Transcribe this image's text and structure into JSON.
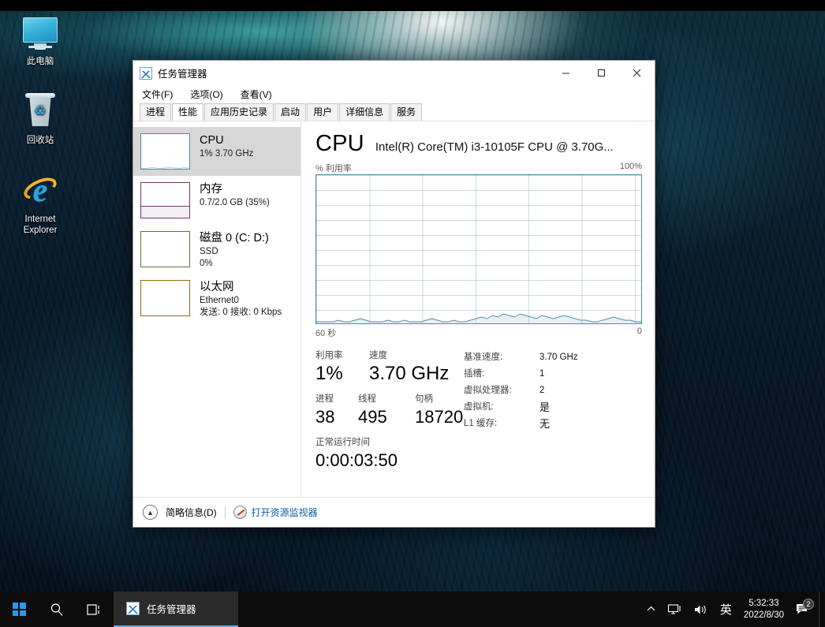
{
  "desktop": {
    "icons": [
      {
        "name": "this-pc",
        "label": "此电脑"
      },
      {
        "name": "recycle-bin",
        "label": "回收站"
      },
      {
        "name": "internet-explorer",
        "label": "Internet Explorer",
        "label_line1": "Internet",
        "label_line2": "Explorer"
      }
    ]
  },
  "window": {
    "title": "任务管理器",
    "icon": "task-manager-icon",
    "buttons": {
      "minimize": "─",
      "maximize": "☐",
      "close": "✕"
    },
    "menu": [
      {
        "name": "file",
        "label": "文件(F)"
      },
      {
        "name": "options",
        "label": "选项(O)"
      },
      {
        "name": "view",
        "label": "查看(V)"
      }
    ],
    "tabs": [
      {
        "name": "processes",
        "label": "进程",
        "active": false
      },
      {
        "name": "performance",
        "label": "性能",
        "active": true
      },
      {
        "name": "app-history",
        "label": "应用历史记录",
        "active": false
      },
      {
        "name": "startup",
        "label": "启动",
        "active": false
      },
      {
        "name": "users",
        "label": "用户",
        "active": false
      },
      {
        "name": "details",
        "label": "详细信息",
        "active": false
      },
      {
        "name": "services",
        "label": "服务",
        "active": false
      }
    ]
  },
  "sidebar": {
    "items": [
      {
        "name": "cpu",
        "title": "CPU",
        "sub1": "1%  3.70 GHz",
        "sub2": "",
        "accent": "#4a8ca5",
        "selected": true
      },
      {
        "name": "memory",
        "title": "内存",
        "sub1": "0.7/2.0 GB (35%)",
        "sub2": "",
        "accent": "#74356b",
        "selected": false
      },
      {
        "name": "disk",
        "title": "磁盘 0 (C: D:)",
        "sub1": "SSD",
        "sub2": "0%",
        "accent": "#5a7a2a",
        "selected": false
      },
      {
        "name": "ethernet",
        "title": "以太网",
        "sub1": "Ethernet0",
        "sub2": "发送: 0 接收: 0 Kbps",
        "accent": "#8a6a1f",
        "selected": false
      }
    ]
  },
  "detail": {
    "heading": "CPU",
    "model": "Intel(R) Core(TM) i3-10105F CPU @ 3.70G...",
    "graph_top_left": "% 利用率",
    "graph_top_right": "100%",
    "graph_bottom_left": "60 秒",
    "graph_bottom_right": "0",
    "stats_left": [
      {
        "name": "utilization",
        "label": "利用率",
        "value": "1%"
      },
      {
        "name": "speed",
        "label": "速度",
        "value": "3.70 GHz"
      },
      {
        "name": "processes",
        "label": "进程",
        "value": "38"
      },
      {
        "name": "threads",
        "label": "线程",
        "value": "495"
      },
      {
        "name": "handles",
        "label": "句柄",
        "value": "18720"
      }
    ],
    "uptime": {
      "label": "正常运行时间",
      "value": "0:00:03:50"
    },
    "stats_right": [
      {
        "name": "base-speed",
        "key": "基准速度:",
        "value": "3.70 GHz"
      },
      {
        "name": "sockets",
        "key": "插槽:",
        "value": "1"
      },
      {
        "name": "virtual-processors",
        "key": "虚拟处理器:",
        "value": "2"
      },
      {
        "name": "virtual-machine",
        "key": "虚拟机:",
        "value": "是"
      },
      {
        "name": "l1-cache",
        "key": "L1 缓存:",
        "value": "无"
      }
    ]
  },
  "statusbar": {
    "fewer_details": "简略信息(D)",
    "resource_monitor": "打开资源监视器"
  },
  "taskbar": {
    "task_button": "任务管理器",
    "ime": "英",
    "time": "5:32:33",
    "date": "2022/8/30",
    "notification_count": "2"
  },
  "chart_data": {
    "type": "area",
    "title": "% 利用率",
    "xlabel": "60 秒",
    "ylabel": "% 利用率",
    "ylim": [
      0,
      100
    ],
    "xlim": [
      60,
      0
    ],
    "grid": true,
    "values": [
      1,
      1,
      1,
      1,
      2,
      1,
      1,
      2,
      3,
      2,
      1,
      1,
      1,
      2,
      1,
      1,
      2,
      1,
      1,
      1,
      2,
      3,
      2,
      1,
      1,
      2,
      1,
      1,
      2,
      3,
      4,
      3,
      5,
      4,
      6,
      5,
      4,
      6,
      5,
      4,
      3,
      5,
      4,
      3,
      4,
      5,
      4,
      3,
      2,
      2,
      1,
      1,
      2,
      3,
      4,
      3,
      2,
      2,
      1,
      1
    ]
  }
}
